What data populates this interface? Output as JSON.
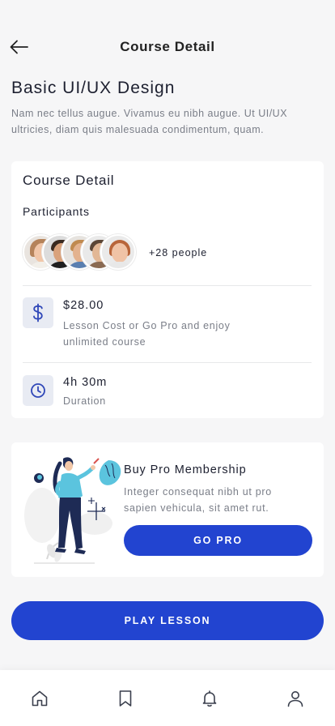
{
  "header": {
    "title": "Course Detail",
    "back_icon": "arrow-left-icon"
  },
  "course": {
    "title": "Basic UI/UX Design",
    "description": "Nam nec tellus augue. Vivamus eu nibh augue. Ut UI/UX ultricies, diam quis malesuada condimentum, quam."
  },
  "detail_card": {
    "title": "Course Detail",
    "participants_label": "Participants",
    "participants_more": "+28 people",
    "price": {
      "icon": "dollar-icon",
      "value": "$28.00",
      "caption": "Lesson Cost or Go Pro and enjoy unlimited course"
    },
    "duration": {
      "icon": "clock-icon",
      "value": "4h 30m",
      "caption": "Duration"
    }
  },
  "pro_card": {
    "title": "Buy Pro Membership",
    "description": "Integer consequat nibh ut pro sapien vehicula, sit amet rut.",
    "button_label": "GO PRO"
  },
  "play_button_label": "PLAY LESSON",
  "bottom_nav": {
    "items": [
      {
        "icon": "home-icon"
      },
      {
        "icon": "bookmark-icon"
      },
      {
        "icon": "bell-icon"
      },
      {
        "icon": "user-icon"
      }
    ]
  },
  "colors": {
    "primary": "#2244d0",
    "icon_blue": "#2f47b8",
    "icon_bg": "#e8ebf3",
    "text_muted": "#7a7e88",
    "background": "#f6f6f7"
  }
}
